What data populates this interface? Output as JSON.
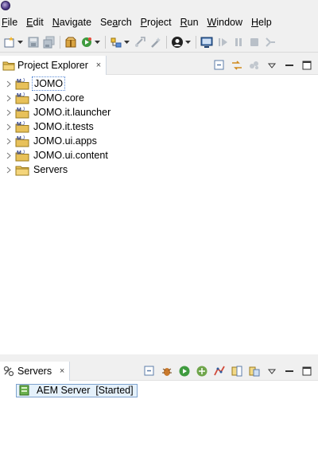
{
  "menubar": {
    "items": [
      {
        "label": "File",
        "mnemonic": "F",
        "rest": "ile"
      },
      {
        "label": "Edit",
        "mnemonic": "E",
        "rest": "dit"
      },
      {
        "label": "Navigate",
        "mnemonic": "N",
        "rest": "avigate"
      },
      {
        "label": "Search",
        "mnemonic": "a",
        "pre": "Se",
        "rest": "rch"
      },
      {
        "label": "Project",
        "mnemonic": "P",
        "rest": "roject"
      },
      {
        "label": "Run",
        "mnemonic": "R",
        "rest": "un"
      },
      {
        "label": "Window",
        "mnemonic": "W",
        "rest": "indow"
      },
      {
        "label": "Help",
        "mnemonic": "H",
        "rest": "elp"
      }
    ]
  },
  "project_explorer": {
    "title": "Project Explorer",
    "items": [
      {
        "label": "JOMO",
        "selected": true
      },
      {
        "label": "JOMO.core",
        "selected": false
      },
      {
        "label": "JOMO.it.launcher",
        "selected": false
      },
      {
        "label": "JOMO.it.tests",
        "selected": false
      },
      {
        "label": "JOMO.ui.apps",
        "selected": false
      },
      {
        "label": "JOMO.ui.content",
        "selected": false
      },
      {
        "label": "Servers",
        "selected": false
      }
    ]
  },
  "servers_view": {
    "title": "Servers",
    "items": [
      {
        "name": "AEM Server",
        "state": "[Started]",
        "label": "AEM Server  [Started]"
      }
    ]
  },
  "colors": {
    "selection_border": "#5a8bd6",
    "server_highlight": "#e5f1fb",
    "folder": "#e8c15a",
    "java_project": "#6e8fcf"
  },
  "icons": {
    "close": "×"
  }
}
